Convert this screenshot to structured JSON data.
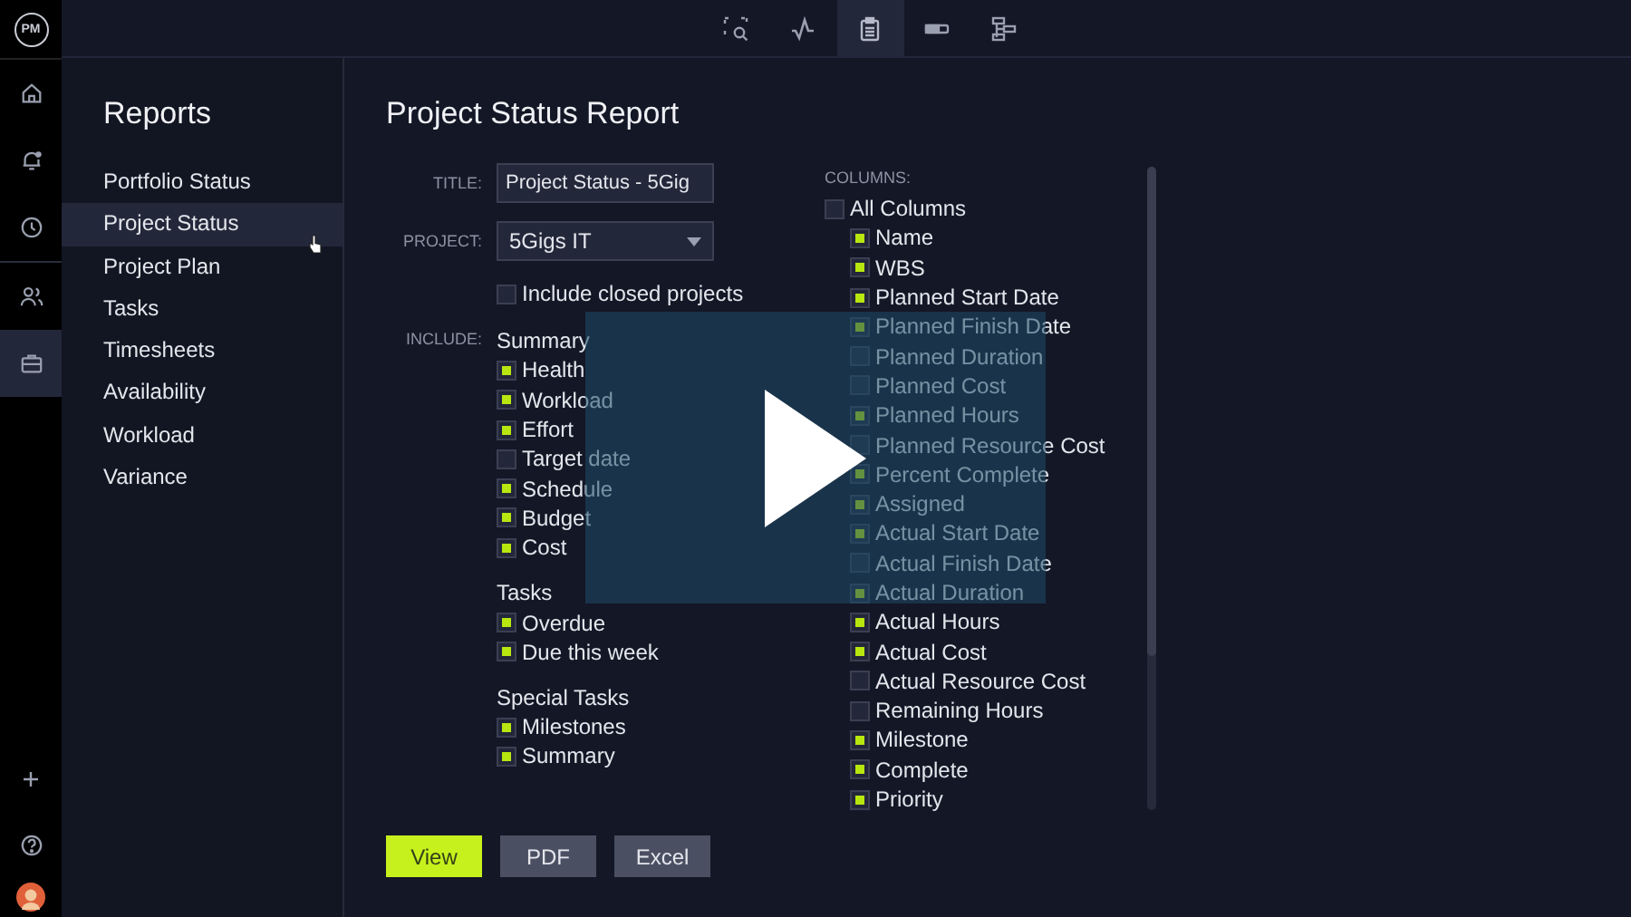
{
  "logo": "PM",
  "rail": {
    "top": [
      {
        "selected": false
      },
      {
        "selected": false
      },
      {
        "selected": false
      },
      {
        "selected": false
      },
      {
        "selected": true
      }
    ],
    "bottom": [
      {
        "selected": false
      },
      {
        "selected": false
      }
    ]
  },
  "toolbar": [
    {
      "selected": false
    },
    {
      "selected": false
    },
    {
      "selected": true
    },
    {
      "selected": false
    },
    {
      "selected": false
    }
  ],
  "sidebar": {
    "title": "Reports",
    "items": [
      {
        "label": "Portfolio Status",
        "selected": false
      },
      {
        "label": "Project Status",
        "selected": true
      },
      {
        "label": "Project Plan",
        "selected": false
      },
      {
        "label": "Tasks",
        "selected": false
      },
      {
        "label": "Timesheets",
        "selected": false
      },
      {
        "label": "Availability",
        "selected": false
      },
      {
        "label": "Workload",
        "selected": false
      },
      {
        "label": "Variance",
        "selected": false
      }
    ]
  },
  "page_title": "Project Status Report",
  "form": {
    "title_label": "TITLE:",
    "title_value": "Project Status - 5Gig",
    "project_label": "PROJECT:",
    "project_value": "5Gigs IT",
    "include_closed": {
      "label": "Include closed projects",
      "checked": false
    },
    "include_label": "INCLUDE:",
    "groups": [
      {
        "heading": "Summary",
        "items": [
          {
            "label": "Health",
            "checked": true
          },
          {
            "label": "Workload",
            "checked": true
          },
          {
            "label": "Effort",
            "checked": true
          },
          {
            "label": "Target date",
            "checked": false
          },
          {
            "label": "Schedule",
            "checked": true
          },
          {
            "label": "Budget",
            "checked": true
          },
          {
            "label": "Cost",
            "checked": true
          }
        ]
      },
      {
        "heading": "Tasks",
        "items": [
          {
            "label": "Overdue",
            "checked": true
          },
          {
            "label": "Due this week",
            "checked": true
          }
        ]
      },
      {
        "heading": "Special Tasks",
        "items": [
          {
            "label": "Milestones",
            "checked": true
          },
          {
            "label": "Summary",
            "checked": true
          }
        ]
      }
    ]
  },
  "columns": {
    "label": "COLUMNS:",
    "all": {
      "label": "All Columns",
      "checked": false
    },
    "items": [
      {
        "label": "Name",
        "checked": true
      },
      {
        "label": "WBS",
        "checked": true
      },
      {
        "label": "Planned Start Date",
        "checked": true
      },
      {
        "label": "Planned Finish Date",
        "checked": true
      },
      {
        "label": "Planned Duration",
        "checked": false
      },
      {
        "label": "Planned Cost",
        "checked": false
      },
      {
        "label": "Planned Hours",
        "checked": true
      },
      {
        "label": "Planned Resource Cost",
        "checked": false
      },
      {
        "label": "Percent Complete",
        "checked": true
      },
      {
        "label": "Assigned",
        "checked": true
      },
      {
        "label": "Actual Start Date",
        "checked": true
      },
      {
        "label": "Actual Finish Date",
        "checked": false
      },
      {
        "label": "Actual Duration",
        "checked": true
      },
      {
        "label": "Actual Hours",
        "checked": true
      },
      {
        "label": "Actual Cost",
        "checked": true
      },
      {
        "label": "Actual Resource Cost",
        "checked": false
      },
      {
        "label": "Remaining Hours",
        "checked": false
      },
      {
        "label": "Milestone",
        "checked": true
      },
      {
        "label": "Complete",
        "checked": true
      },
      {
        "label": "Priority",
        "checked": true
      }
    ]
  },
  "buttons": [
    {
      "label": "View",
      "kind": "primary"
    },
    {
      "label": "PDF",
      "kind": "secondary"
    },
    {
      "label": "Excel",
      "kind": "secondary"
    }
  ]
}
